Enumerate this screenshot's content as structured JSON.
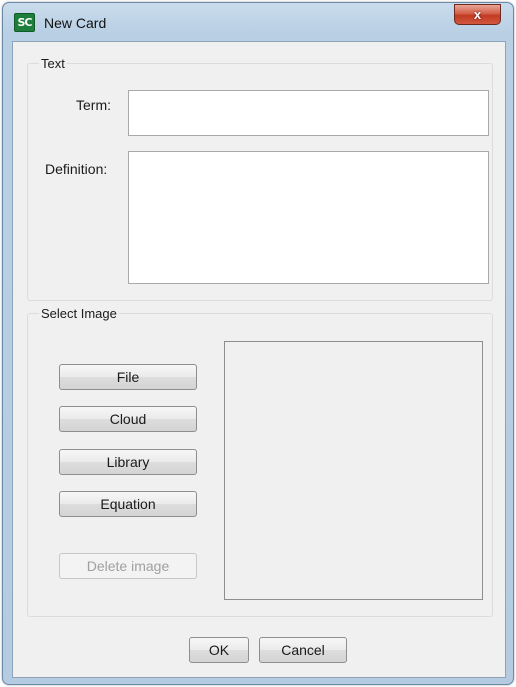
{
  "window": {
    "title": "New Card",
    "icon_text": "SC",
    "close_glyph": "x"
  },
  "text_group": {
    "title": "Text",
    "term_label": "Term:",
    "term_value": "",
    "definition_label": "Definition:",
    "definition_value": ""
  },
  "image_group": {
    "title": "Select Image",
    "buttons": {
      "file": "File",
      "cloud": "Cloud",
      "library": "Library",
      "equation": "Equation",
      "delete": "Delete image"
    }
  },
  "footer": {
    "ok": "OK",
    "cancel": "Cancel"
  },
  "colors": {
    "client_bg": "#f0f0f0",
    "frame": "#b9cfe4",
    "close_button": "#c8432b",
    "app_icon": "#1d7f3b"
  }
}
